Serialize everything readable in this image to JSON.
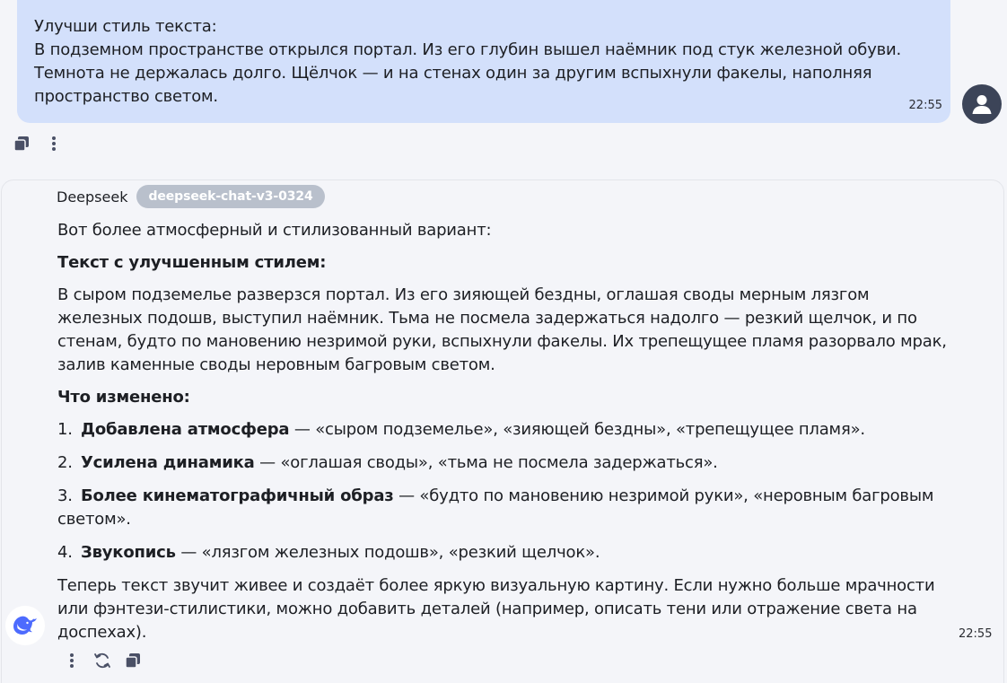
{
  "user_message": {
    "lines": [
      "Улучши стиль текста:",
      "В подземном пространстве открылся портал. Из его глубин вышел наёмник под стук железной обуви.",
      "Темнота не держалась долго. Щёлчок — и на стенах один за другим вспыхнули факелы, наполняя",
      "пространство светом."
    ],
    "time": "22:55",
    "avatar_icon": "user-icon"
  },
  "user_actions": {
    "copy_icon": "copy-icon",
    "more_icon": "more-vertical-icon"
  },
  "assistant": {
    "sender": "Deepseek",
    "model": "deepseek-chat-v3-0324",
    "intro": "Вот более атмосферный и стилизованный вариант:",
    "heading1": "Текст с улучшенным стилем:",
    "paragraph": "В сыром подземелье разверзся портал. Из его зияющей бездны, оглашая своды мерным лязгом железных подошв, выступил наёмник. Тьма не посмела задержаться надолго — резкий щелчок, и по стенам, будто по мановению незримой руки, вспыхнули факелы. Их трепещущее пламя разорвало мрак, залив каменные своды неровным багровым светом.",
    "paragraph_lines": [
      "В сыром подземелье разверзся портал. Из его зияющей бездны, оглашая своды мерным лязгом",
      "железных подошв, выступил наёмник. Тьма не посмела задержаться надолго — резкий щелчок, и по",
      "стенам, будто по мановению незримой руки, вспыхнули факелы. Их трепещущее пламя разорвало мрак,",
      "залив каменные своды неровным багровым светом."
    ],
    "heading2": "Что изменено:",
    "changes": [
      {
        "num": "1.",
        "bold": "Добавлена атмосфера",
        "rest": " — «сыром подземелье», «зияющей бездны», «трепещущее пламя»."
      },
      {
        "num": "2.",
        "bold": "Усилена динамика",
        "rest": " — «оглашая своды», «тьма не посмела задержаться»."
      },
      {
        "num": "3.",
        "bold": "Более кинематографичный образ",
        "rest": " — «будто по мановению незримой руки», «неровным багровым",
        "rest2": "светом»."
      },
      {
        "num": "4.",
        "bold": "Звукопись",
        "rest": " — «лязгом железных подошв», «резкий щелчок»."
      }
    ],
    "closing_lines": [
      "Теперь текст звучит живее и создаёт более яркую визуальную картину. Если нужно больше мрачности",
      "или фэнтези-стилистики, можно добавить деталей (например, описать тени или отражение света на",
      "доспехах)."
    ],
    "time": "22:55",
    "avatar_icon": "deepseek-whale-icon"
  },
  "assistant_actions": {
    "more_icon": "more-vertical-icon",
    "regenerate_icon": "regenerate-icon",
    "copy_icon": "copy-icon"
  },
  "colors": {
    "user_bubble": "#d3e0fb",
    "background": "#f4f5f9",
    "badge": "#b9c0cc",
    "avatar": "#3c4458",
    "deepseek_blue": "#4d6bfe"
  }
}
